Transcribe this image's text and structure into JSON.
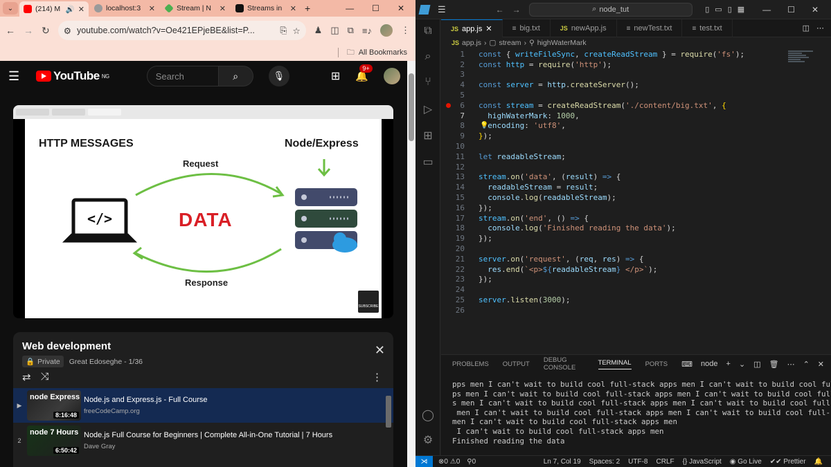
{
  "chrome": {
    "tabs": [
      {
        "label": "(214) M",
        "icon": "youtube-icon"
      },
      {
        "label": "localhost:3",
        "icon": "globe-icon"
      },
      {
        "label": "Stream | N",
        "icon": "node-icon"
      },
      {
        "label": "Streams in",
        "icon": "medium-icon"
      }
    ],
    "url": "youtube.com/watch?v=Oe421EPjeBE&list=P...",
    "bookmarks_label": "All Bookmarks"
  },
  "youtube": {
    "logo": "YouTube",
    "region": "NG",
    "search_placeholder": "Search",
    "notification_count": "9+",
    "slide": {
      "title_left": "HTTP MESSAGES",
      "title_right": "Node/Express",
      "request": "Request",
      "response": "Response",
      "data": "DATA",
      "subscribe": "SUBSCRIBE"
    },
    "playlist": {
      "title": "Web development",
      "privacy": "Private",
      "owner": "Great Edoseghe - 1/36",
      "items": [
        {
          "index": "▶",
          "title": "Node.js and Express.js - Full Course",
          "channel": "freeCodeCamp.org",
          "duration": "8:16:48",
          "thumb_text": "node Express"
        },
        {
          "index": "2",
          "title": "Node.js Full Course for Beginners | Complete All-in-One Tutorial | 7 Hours",
          "channel": "Dave Gray",
          "duration": "6:50:42",
          "thumb_text": "node 7 Hours"
        }
      ]
    }
  },
  "vscode": {
    "title": "node_tut",
    "tabs": [
      {
        "label": "app.js",
        "type": "JS",
        "active": true
      },
      {
        "label": "big.txt",
        "type": "txt"
      },
      {
        "label": "newApp.js",
        "type": "JS"
      },
      {
        "label": "newTest.txt",
        "type": "txt"
      },
      {
        "label": "test.txt",
        "type": "txt"
      }
    ],
    "breadcrumb": [
      "app.js",
      "stream",
      "highWaterMark"
    ],
    "line_numbers": [
      "1",
      "2",
      "3",
      "4",
      "5",
      "6",
      "7",
      "8",
      "9",
      "10",
      "11",
      "12",
      "13",
      "14",
      "15",
      "16",
      "17",
      "18",
      "19",
      "20",
      "21",
      "22",
      "23",
      "24",
      "25",
      "26"
    ],
    "panel_tabs": [
      "PROBLEMS",
      "OUTPUT",
      "DEBUG CONSOLE",
      "TERMINAL",
      "PORTS"
    ],
    "terminal_name": "node",
    "terminal_lines": [
      "pps men I can't wait to build cool full-stack apps men I can't wait to build cool full-stack ap",
      "ps men I can't wait to build cool full-stack apps men I can't wait to build cool full-stack app",
      "s men I can't wait to build cool full-stack apps men I can't wait to build cool full-stack apps",
      " men I can't wait to build cool full-stack apps men I can't wait to build cool full-stack apps",
      "men I can't wait to build cool full-stack apps men",
      " I can't wait to build cool full-stack apps men",
      "Finished reading the data"
    ],
    "status": {
      "errors": "0",
      "warnings": "0",
      "ports": "0",
      "position": "Ln 7, Col 19",
      "spaces": "Spaces: 2",
      "encoding": "UTF-8",
      "eol": "CRLF",
      "language": "JavaScript",
      "golive": "Go Live",
      "prettier": "Prettier"
    }
  }
}
